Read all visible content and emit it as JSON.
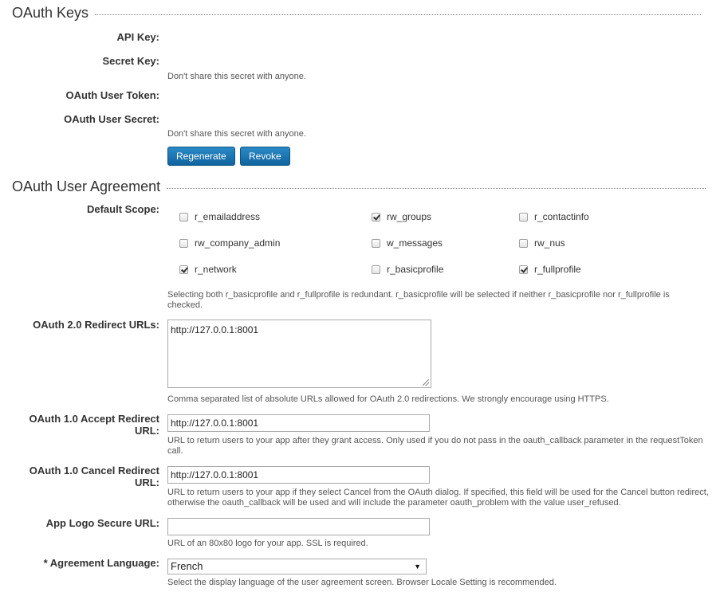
{
  "oauth_keys": {
    "title": "OAuth Keys",
    "api_key_label": "API Key:",
    "api_key_value": "",
    "secret_key_label": "Secret Key:",
    "secret_key_value": "",
    "secret_help": "Don't share this secret with anyone.",
    "user_token_label": "OAuth User Token:",
    "user_token_value": "",
    "user_secret_label": "OAuth User Secret:",
    "user_secret_value": "",
    "user_secret_help": "Don't share this secret with anyone.",
    "regenerate_label": "Regenerate",
    "revoke_label": "Revoke"
  },
  "agreement": {
    "title": "OAuth User Agreement",
    "default_scope_label": "Default Scope:",
    "scopes": [
      {
        "name": "r_emailaddress",
        "checked": false
      },
      {
        "name": "rw_groups",
        "checked": true
      },
      {
        "name": "r_contactinfo",
        "checked": false
      },
      {
        "name": "rw_company_admin",
        "checked": false
      },
      {
        "name": "w_messages",
        "checked": false
      },
      {
        "name": "rw_nus",
        "checked": false
      },
      {
        "name": "r_network",
        "checked": true
      },
      {
        "name": "r_basicprofile",
        "checked": false
      },
      {
        "name": "r_fullprofile",
        "checked": true
      }
    ],
    "scope_help": "Selecting both r_basicprofile and r_fullprofile is redundant. r_basicprofile will be selected if neither r_basicprofile nor r_fullprofile is checked.",
    "redirect_urls_label": "OAuth 2.0 Redirect URLs:",
    "redirect_urls_value": "http://127.0.0.1:8001",
    "redirect_urls_help": "Comma separated list of absolute URLs allowed for OAuth 2.0 redirections. We strongly encourage using HTTPS.",
    "accept_url_label": "OAuth 1.0 Accept Redirect URL:",
    "accept_url_value": "http://127.0.0.1:8001",
    "accept_url_help": "URL to return users to your app after they grant access. Only used if you do not pass in the oauth_callback parameter in the requestToken call.",
    "cancel_url_label": "OAuth 1.0 Cancel Redirect URL:",
    "cancel_url_value": "http://127.0.0.1:8001",
    "cancel_url_help": "URL to return users to your app if they select Cancel from the OAuth dialog. If specified, this field will be used for the Cancel button redirect, otherwise the oauth_callback will be used and will include the parameter oauth_problem with the value user_refused.",
    "logo_url_label": "App Logo Secure URL:",
    "logo_url_value": "",
    "logo_url_help": "URL of an 80x80 logo for your app. SSL is required.",
    "language_label": "* Agreement Language:",
    "language_value": "French",
    "language_help": "Select the display language of the user agreement screen. Browser Locale Setting is recommended."
  },
  "icons": {
    "dropdown_arrow": "▼"
  }
}
